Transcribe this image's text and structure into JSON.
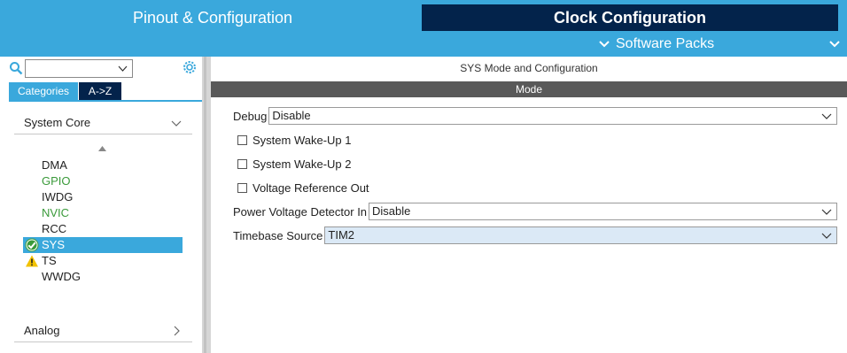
{
  "header": {
    "tab_pinout": "Pinout & Configuration",
    "tab_clock": "Clock Configuration",
    "software_packs": "Software Packs"
  },
  "colors": {
    "accent_blue": "#3aa8dc",
    "navy": "#03234b",
    "mode_bar": "#595959",
    "enabled_green": "#3a9a3a",
    "warning_yellow": "#f2c200"
  },
  "sidebar": {
    "search": {
      "value": ""
    },
    "tabs": {
      "categories": "Categories",
      "az": "A->Z"
    },
    "system_core": "System Core",
    "items": [
      {
        "label": "DMA",
        "state": "normal"
      },
      {
        "label": "GPIO",
        "state": "enabled"
      },
      {
        "label": "IWDG",
        "state": "normal"
      },
      {
        "label": "NVIC",
        "state": "enabled"
      },
      {
        "label": "RCC",
        "state": "normal"
      },
      {
        "label": "SYS",
        "state": "selected",
        "icon": "check-circle-icon"
      },
      {
        "label": "TS",
        "state": "warning",
        "icon": "warning-icon"
      },
      {
        "label": "WWDG",
        "state": "normal"
      }
    ],
    "analog": "Analog"
  },
  "main": {
    "title": "SYS Mode and Configuration",
    "mode_header": "Mode",
    "debug": {
      "label": "Debug",
      "value": "Disable"
    },
    "checkboxes": [
      {
        "label": "System Wake-Up 1",
        "checked": false
      },
      {
        "label": "System Wake-Up 2",
        "checked": false
      },
      {
        "label": "Voltage Reference Out",
        "checked": false
      }
    ],
    "pvd": {
      "label": "Power Voltage Detector In",
      "value": "Disable"
    },
    "timebase": {
      "label": "Timebase Source",
      "value": "TIM2"
    }
  }
}
